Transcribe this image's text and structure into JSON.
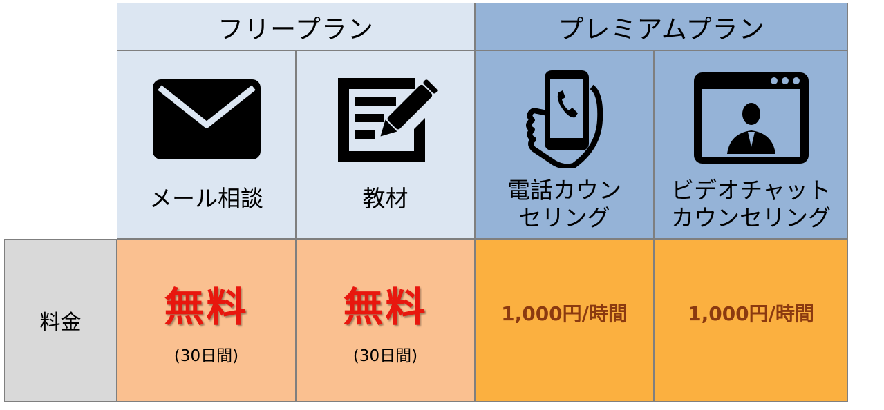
{
  "plans": {
    "free": {
      "title": "フリープラン"
    },
    "premium": {
      "title": "プレミアムプラン"
    }
  },
  "features": [
    {
      "name": "メール相談",
      "icon": "envelope-icon"
    },
    {
      "name": "教材",
      "icon": "notebook-pen-icon"
    },
    {
      "name_lines": [
        "電話カウン",
        "セリング"
      ],
      "icon": "phone-in-hand-icon"
    },
    {
      "name_lines": [
        "ビデオチャット",
        "カウンセリング"
      ],
      "icon": "video-chat-window-icon"
    }
  ],
  "price_row": {
    "label": "料金",
    "free_cells": [
      {
        "price": "無料",
        "note": "(30日間)"
      },
      {
        "price": "無料",
        "note": "(30日間)"
      }
    ],
    "premium_cells": [
      {
        "price": "1,000円/時間"
      },
      {
        "price": "1,000円/時間"
      }
    ]
  },
  "colors": {
    "free_header": "#dce6f2",
    "premium_header": "#95b3d7",
    "free_price_bg": "#fac090",
    "premium_price_bg": "#fbb040",
    "free_text": "#e8170e",
    "premium_price_text": "#8b3a10",
    "label_bg": "#d9d9d9"
  }
}
